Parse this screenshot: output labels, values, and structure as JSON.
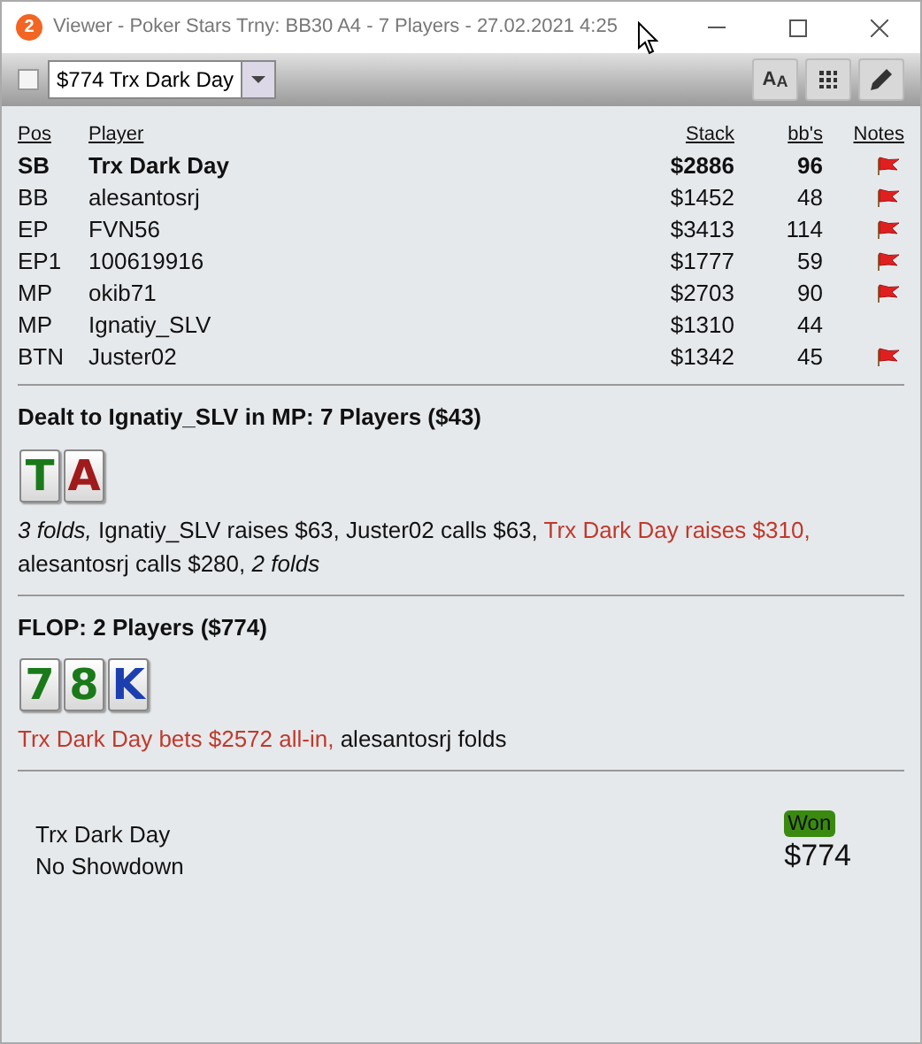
{
  "window": {
    "badge": "2",
    "title": "Viewer - Poker Stars Trny: BB30 A4 - 7 Players - 27.02.2021 4:25"
  },
  "toolbar": {
    "checked": false,
    "hand_select": "$774 Trx Dark Day",
    "font_button": "AA"
  },
  "table": {
    "columns": [
      "Pos",
      "Player",
      "Stack",
      "bb's",
      "Notes"
    ],
    "rows": [
      {
        "pos": "SB",
        "player": "Trx Dark Day",
        "stack": "$2886",
        "bbs": "96",
        "note": true,
        "hero": true
      },
      {
        "pos": "BB",
        "player": "alesantosrj",
        "stack": "$1452",
        "bbs": "48",
        "note": true,
        "hero": false
      },
      {
        "pos": "EP",
        "player": "FVN56",
        "stack": "$3413",
        "bbs": "114",
        "note": true,
        "hero": false
      },
      {
        "pos": "EP1",
        "player": "100619916",
        "stack": "$1777",
        "bbs": "59",
        "note": true,
        "hero": false
      },
      {
        "pos": "MP",
        "player": "okib71",
        "stack": "$2703",
        "bbs": "90",
        "note": true,
        "hero": false
      },
      {
        "pos": "MP",
        "player": "Ignatiy_SLV",
        "stack": "$1310",
        "bbs": "44",
        "note": false,
        "hero": false
      },
      {
        "pos": "BTN",
        "player": "Juster02",
        "stack": "$1342",
        "bbs": "45",
        "note": true,
        "hero": false
      }
    ]
  },
  "streets": [
    {
      "heading": "Dealt to Ignatiy_SLV in MP: 7 Players ($43)",
      "cards": [
        {
          "rank": "T",
          "color": "#1a7a1a"
        },
        {
          "rank": "A",
          "color": "#a01c1c"
        }
      ],
      "actions": [
        {
          "kind": "folds",
          "text": "3 folds,"
        },
        {
          "kind": "plain",
          "text": "Ignatiy_SLV raises $63, Juster02 calls $63,"
        },
        {
          "kind": "hero",
          "text": "Trx Dark Day raises $310,"
        },
        {
          "kind": "plain",
          "text": "alesantosrj calls $280,"
        },
        {
          "kind": "folds",
          "text": "2 folds"
        }
      ]
    },
    {
      "heading": "FLOP: 2 Players ($774)",
      "cards": [
        {
          "rank": "7",
          "color": "#1a7a1a"
        },
        {
          "rank": "8",
          "color": "#1a7a1a"
        },
        {
          "rank": "K",
          "color": "#1c3fb0"
        }
      ],
      "actions": [
        {
          "kind": "hero",
          "text": "Trx Dark Day bets $2572 all-in,"
        },
        {
          "kind": "plain",
          "text": "alesantosrj folds"
        }
      ]
    }
  ],
  "result": {
    "player": "Trx Dark Day",
    "detail": "No Showdown",
    "outcome": "Won",
    "amount": "$774"
  }
}
